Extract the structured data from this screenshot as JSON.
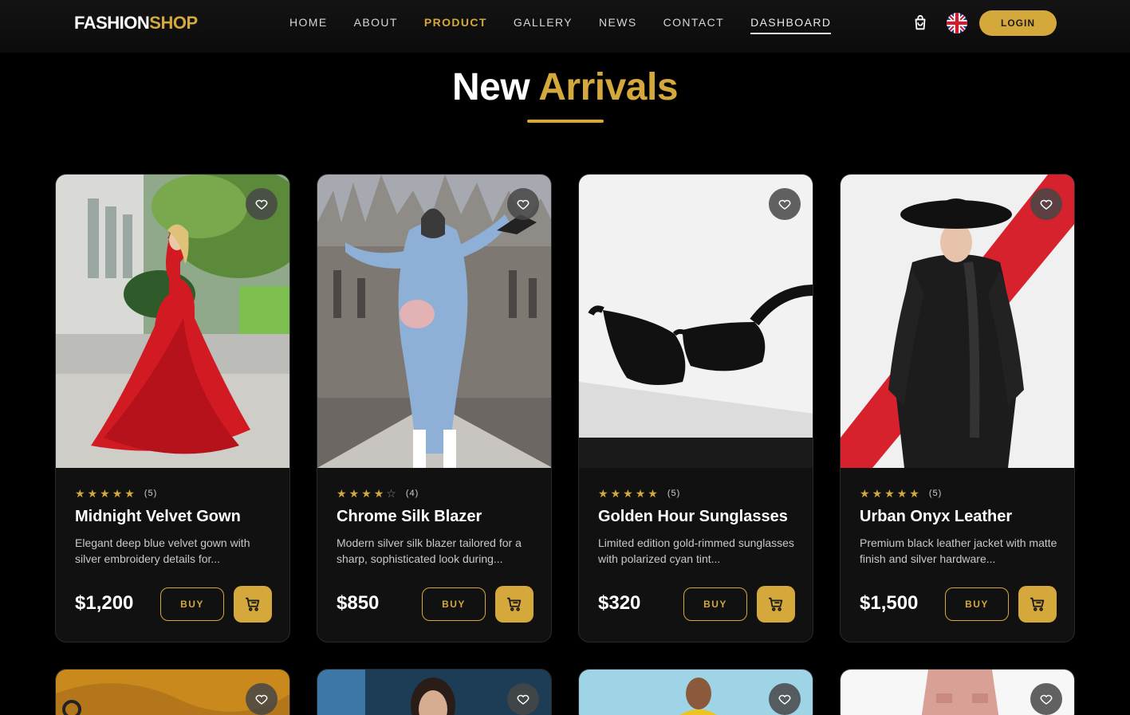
{
  "header": {
    "logo_part1": "FASHION",
    "logo_part2": "SHOP",
    "nav": [
      "HOME",
      "ABOUT",
      "PRODUCT",
      "GALLERY",
      "NEWS",
      "CONTACT",
      "DASHBOARD"
    ],
    "active_nav": "PRODUCT",
    "login_label": "LOGIN",
    "language_icon": "uk-flag-icon"
  },
  "section": {
    "title_part1": "New",
    "title_part2": "Arrivals"
  },
  "colors": {
    "accent": "#d4a83a",
    "background": "#000000",
    "card": "#111111"
  },
  "products": [
    {
      "rating": 5,
      "rating_count": "(5)",
      "name": "Midnight Velvet Gown",
      "description": "Elegant deep blue velvet gown with silver embroidery details for...",
      "price": "$1,200",
      "buy_label": "BUY"
    },
    {
      "rating": 4,
      "rating_count": "(4)",
      "name": "Chrome Silk Blazer",
      "description": "Modern silver silk blazer tailored for a sharp, sophisticated look during...",
      "price": "$850",
      "buy_label": "BUY"
    },
    {
      "rating": 5,
      "rating_count": "(5)",
      "name": "Golden Hour Sunglasses",
      "description": "Limited edition gold-rimmed sunglasses with polarized cyan tint...",
      "price": "$320",
      "buy_label": "BUY"
    },
    {
      "rating": 5,
      "rating_count": "(5)",
      "name": "Urban Onyx Leather",
      "description": "Premium black leather jacket with matte finish and silver hardware...",
      "price": "$1,500",
      "buy_label": "BUY"
    }
  ]
}
